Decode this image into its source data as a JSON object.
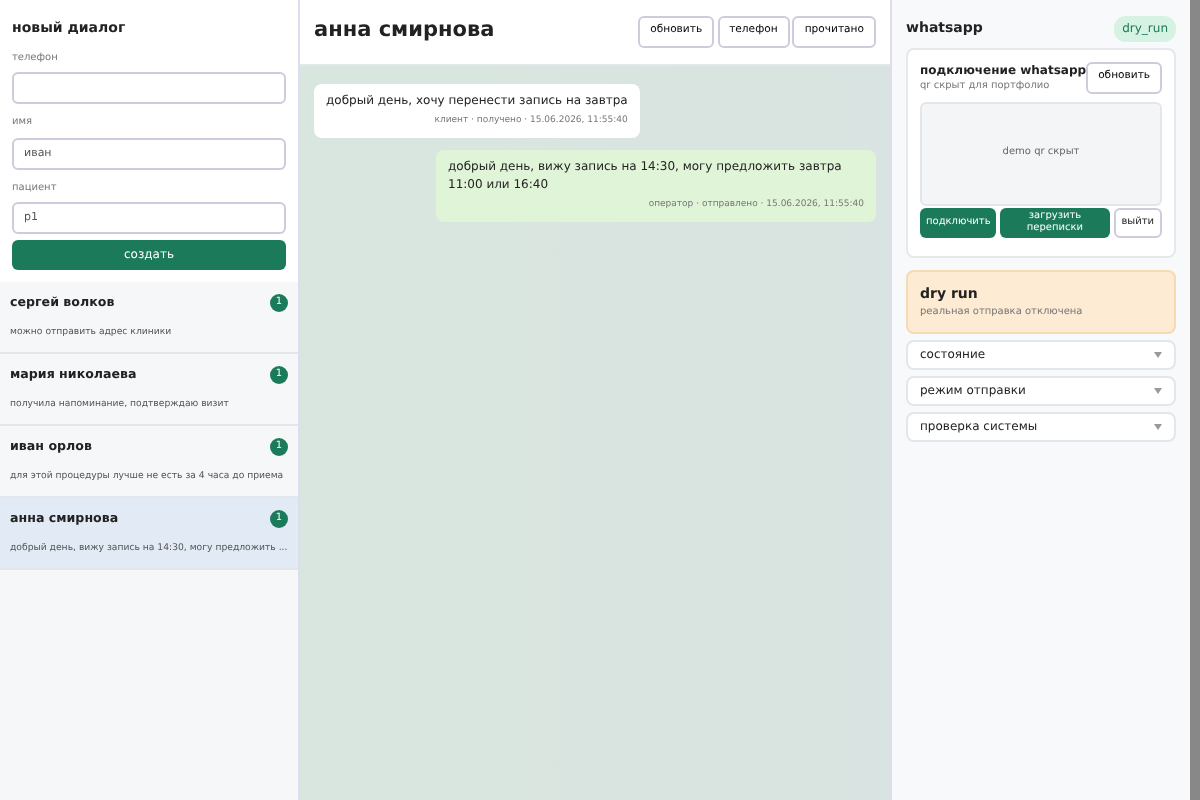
{
  "new_dialog": {
    "title": "новый диалог",
    "fields": [
      {
        "label": "телефон"
      },
      {
        "label": "имя",
        "value": "иван"
      },
      {
        "label": "пациент",
        "value": "p1"
      }
    ],
    "create_button": "создать"
  },
  "conversations": [
    {
      "name": "сергей волков",
      "badge": "1",
      "preview": "можно отправить адрес клиники",
      "selected": false
    },
    {
      "name": "мария николаева",
      "badge": "1",
      "preview": "получила напоминание, подтверждаю визит",
      "selected": false
    },
    {
      "name": "иван орлов",
      "badge": "1",
      "preview": "для этой процедуры лучше не есть за 4 часа до приема",
      "selected": false
    },
    {
      "name": "анна смирнова",
      "badge": "1",
      "preview": "добрый день, вижу запись на 14:30, могу предложить ...",
      "selected": true
    }
  ],
  "chat": {
    "title": "анна смирнова",
    "buttons": [
      "обновить",
      "телефон",
      "прочитано"
    ],
    "messages": [
      {
        "kind": "incoming",
        "text": "добрый день, хочу перенести запись на завтра",
        "meta": "клиент · получено · 15.06.2026, 11:55:40"
      },
      {
        "kind": "outgoing",
        "text": "добрый день, вижу запись на 14:30, могу предложить завтра 11:00 или 16:40",
        "meta": "оператор · отправлено · 15.06.2026, 11:55:40"
      }
    ]
  },
  "side": {
    "title": "whatsapp",
    "mode_badge": "dry_run",
    "connection": {
      "title": "подключение whatsapp",
      "subtitle": "qr скрыт для портфолио",
      "refresh_button": "обновить",
      "qr_placeholder": "demo qr скрыт",
      "buttons": [
        {
          "kind": "primary",
          "label": "подключить"
        },
        {
          "kind": "primary",
          "label": "загрузить переписки"
        },
        {
          "kind": "outline",
          "label": "выйти"
        }
      ]
    },
    "alert": {
      "title": "dry run",
      "text": "реальная отправка отключена"
    },
    "sections": [
      {
        "label": "состояние",
        "expanded": false
      },
      {
        "label": "режим отправки",
        "expanded": false
      },
      {
        "label": "проверка системы",
        "expanded": false
      }
    ]
  }
}
